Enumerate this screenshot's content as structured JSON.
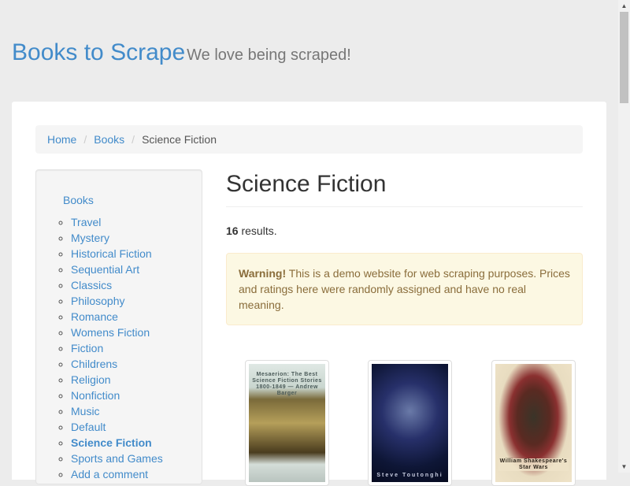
{
  "header": {
    "brand": "Books to Scrape",
    "tagline": "We love being scraped!"
  },
  "breadcrumb": [
    {
      "label": "Home"
    },
    {
      "label": "Books"
    },
    {
      "label": "Science Fiction"
    }
  ],
  "sidebar": {
    "root": "Books",
    "items": [
      "Travel",
      "Mystery",
      "Historical Fiction",
      "Sequential Art",
      "Classics",
      "Philosophy",
      "Romance",
      "Womens Fiction",
      "Fiction",
      "Childrens",
      "Religion",
      "Nonfiction",
      "Music",
      "Default",
      "Science Fiction",
      "Sports and Games",
      "Add a comment"
    ],
    "active": "Science Fiction"
  },
  "main": {
    "title": "Science Fiction",
    "results_count": "16",
    "results_suffix": " results.",
    "alert_strong": "Warning!",
    "alert_text": " This is a demo website for web scraping purposes. Prices and ratings here were randomly assigned and have no real meaning."
  },
  "books": [
    {
      "cover": "Mesaerion: The Best Science Fiction Stories 1800-1849 — Andrew Barger"
    },
    {
      "cover": "Steve Toutonghi"
    },
    {
      "cover": "William Shakespeare's Star Wars"
    }
  ],
  "colors": {
    "link": "#428bca",
    "alert_bg": "#fcf8e3",
    "alert_text": "#8a6d3b"
  }
}
